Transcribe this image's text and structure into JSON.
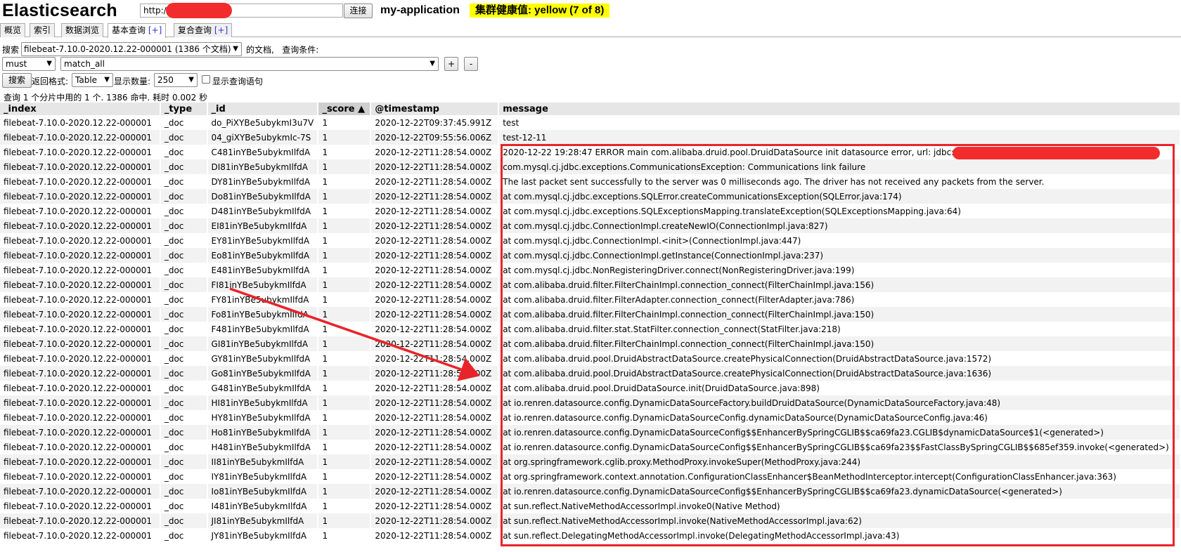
{
  "header": {
    "logo": "Elasticsearch",
    "url_value": "http://              9200/",
    "connect_label": "连接",
    "cluster_name": "my-application",
    "health_text": "集群健康值: yellow (7 of 8)",
    "health_color": "#ffff00"
  },
  "tabs": [
    {
      "label": "概览"
    },
    {
      "label": "索引"
    },
    {
      "label": "数据浏览"
    },
    {
      "label": "基本查询",
      "plus": "[+]"
    },
    {
      "label": "复合查询",
      "plus": "[+]"
    }
  ],
  "search": {
    "search_label": "搜索",
    "index_selected": "filebeat-7.10.0-2020.12.22-000001 (1386 个文档)",
    "of_docs_label": "的文档,",
    "query_cond_label": "查询条件:",
    "bool_selected": "must",
    "query_selected": "match_all",
    "add_label": "+",
    "remove_label": "-",
    "search_button": "搜索",
    "return_format_label": "返回格式:",
    "format_selected": "Table",
    "count_label": "显示数量:",
    "count_selected": "250",
    "show_query_label": "显示查询语句",
    "summary": "查询 1 个分片中用的 1 个. 1386 命中. 耗时 0.002 秒"
  },
  "table": {
    "columns": [
      "_index",
      "_type",
      "_id",
      "_score ▲",
      "@timestamp",
      "message"
    ],
    "rows": [
      [
        "filebeat-7.10.0-2020.12.22-000001",
        "_doc",
        "do_PiXYBe5ubykmI3u7V",
        "1",
        "2020-12-22T09:37:45.991Z",
        "test"
      ],
      [
        "filebeat-7.10.0-2020.12.22-000001",
        "_doc",
        "04_giXYBe5ubykmIc-7S",
        "1",
        "2020-12-22T09:55:56.006Z",
        "test-12-11"
      ],
      [
        "filebeat-7.10.0-2020.12.22-000001",
        "_doc",
        "C481inYBe5ubykmIlfdA",
        "1",
        "2020-12-22T11:28:54.000Z",
        "2020-12-22 19:28:47 ERROR main com.alibaba.druid.pool.DruidDataSource init datasource error, url: jdbc:                                                        :3306/"
      ],
      [
        "filebeat-7.10.0-2020.12.22-000001",
        "_doc",
        "DI81inYBe5ubykmIlfdA",
        "1",
        "2020-12-22T11:28:54.000Z",
        "com.mysql.cj.jdbc.exceptions.CommunicationsException: Communications link failure"
      ],
      [
        "filebeat-7.10.0-2020.12.22-000001",
        "_doc",
        "DY81inYBe5ubykmIlfdA",
        "1",
        "2020-12-22T11:28:54.000Z",
        "The last packet sent successfully to the server was 0 milliseconds ago. The driver has not received any packets from the server."
      ],
      [
        "filebeat-7.10.0-2020.12.22-000001",
        "_doc",
        "Do81inYBe5ubykmIlfdA",
        "1",
        "2020-12-22T11:28:54.000Z",
        "at com.mysql.cj.jdbc.exceptions.SQLError.createCommunicationsException(SQLError.java:174)"
      ],
      [
        "filebeat-7.10.0-2020.12.22-000001",
        "_doc",
        "D481inYBe5ubykmIlfdA",
        "1",
        "2020-12-22T11:28:54.000Z",
        "at com.mysql.cj.jdbc.exceptions.SQLExceptionsMapping.translateException(SQLExceptionsMapping.java:64)"
      ],
      [
        "filebeat-7.10.0-2020.12.22-000001",
        "_doc",
        "EI81inYBe5ubykmIlfdA",
        "1",
        "2020-12-22T11:28:54.000Z",
        "at com.mysql.cj.jdbc.ConnectionImpl.createNewIO(ConnectionImpl.java:827)"
      ],
      [
        "filebeat-7.10.0-2020.12.22-000001",
        "_doc",
        "EY81inYBe5ubykmIlfdA",
        "1",
        "2020-12-22T11:28:54.000Z",
        "at com.mysql.cj.jdbc.ConnectionImpl.<init>(ConnectionImpl.java:447)"
      ],
      [
        "filebeat-7.10.0-2020.12.22-000001",
        "_doc",
        "Eo81inYBe5ubykmIlfdA",
        "1",
        "2020-12-22T11:28:54.000Z",
        "at com.mysql.cj.jdbc.ConnectionImpl.getInstance(ConnectionImpl.java:237)"
      ],
      [
        "filebeat-7.10.0-2020.12.22-000001",
        "_doc",
        "E481inYBe5ubykmIlfdA",
        "1",
        "2020-12-22T11:28:54.000Z",
        "at com.mysql.cj.jdbc.NonRegisteringDriver.connect(NonRegisteringDriver.java:199)"
      ],
      [
        "filebeat-7.10.0-2020.12.22-000001",
        "_doc",
        "FI81inYBe5ubykmIlfdA",
        "1",
        "2020-12-22T11:28:54.000Z",
        "at com.alibaba.druid.filter.FilterChainImpl.connection_connect(FilterChainImpl.java:156)"
      ],
      [
        "filebeat-7.10.0-2020.12.22-000001",
        "_doc",
        "FY81inYBe5ubykmIlfdA",
        "1",
        "2020-12-22T11:28:54.000Z",
        "at com.alibaba.druid.filter.FilterAdapter.connection_connect(FilterAdapter.java:786)"
      ],
      [
        "filebeat-7.10.0-2020.12.22-000001",
        "_doc",
        "Fo81inYBe5ubykmIlfdA",
        "1",
        "2020-12-22T11:28:54.000Z",
        "at com.alibaba.druid.filter.FilterChainImpl.connection_connect(FilterChainImpl.java:150)"
      ],
      [
        "filebeat-7.10.0-2020.12.22-000001",
        "_doc",
        "F481inYBe5ubykmIlfdA",
        "1",
        "2020-12-22T11:28:54.000Z",
        "at com.alibaba.druid.filter.stat.StatFilter.connection_connect(StatFilter.java:218)"
      ],
      [
        "filebeat-7.10.0-2020.12.22-000001",
        "_doc",
        "GI81inYBe5ubykmIlfdA",
        "1",
        "2020-12-22T11:28:54.000Z",
        "at com.alibaba.druid.filter.FilterChainImpl.connection_connect(FilterChainImpl.java:150)"
      ],
      [
        "filebeat-7.10.0-2020.12.22-000001",
        "_doc",
        "GY81inYBe5ubykmIlfdA",
        "1",
        "2020-12-22T11:28:54.000Z",
        "at com.alibaba.druid.pool.DruidAbstractDataSource.createPhysicalConnection(DruidAbstractDataSource.java:1572)"
      ],
      [
        "filebeat-7.10.0-2020.12.22-000001",
        "_doc",
        "Go81inYBe5ubykmIlfdA",
        "1",
        "2020-12-22T11:28:54.000Z",
        "at com.alibaba.druid.pool.DruidAbstractDataSource.createPhysicalConnection(DruidAbstractDataSource.java:1636)"
      ],
      [
        "filebeat-7.10.0-2020.12.22-000001",
        "_doc",
        "G481inYBe5ubykmIlfdA",
        "1",
        "2020-12-22T11:28:54.000Z",
        "at com.alibaba.druid.pool.DruidDataSource.init(DruidDataSource.java:898)"
      ],
      [
        "filebeat-7.10.0-2020.12.22-000001",
        "_doc",
        "HI81inYBe5ubykmIlfdA",
        "1",
        "2020-12-22T11:28:54.000Z",
        "at io.renren.datasource.config.DynamicDataSourceFactory.buildDruidDataSource(DynamicDataSourceFactory.java:48)"
      ],
      [
        "filebeat-7.10.0-2020.12.22-000001",
        "_doc",
        "HY81inYBe5ubykmIlfdA",
        "1",
        "2020-12-22T11:28:54.000Z",
        "at io.renren.datasource.config.DynamicDataSourceConfig.dynamicDataSource(DynamicDataSourceConfig.java:46)"
      ],
      [
        "filebeat-7.10.0-2020.12.22-000001",
        "_doc",
        "Ho81inYBe5ubykmIlfdA",
        "1",
        "2020-12-22T11:28:54.000Z",
        "at io.renren.datasource.config.DynamicDataSourceConfig$$EnhancerBySpringCGLIB$$ca69fa23.CGLIB$dynamicDataSource$1(<generated>)"
      ],
      [
        "filebeat-7.10.0-2020.12.22-000001",
        "_doc",
        "H481inYBe5ubykmIlfdA",
        "1",
        "2020-12-22T11:28:54.000Z",
        "at io.renren.datasource.config.DynamicDataSourceConfig$$EnhancerBySpringCGLIB$$ca69fa23$$FastClassBySpringCGLIB$$685ef359.invoke(<generated>)"
      ],
      [
        "filebeat-7.10.0-2020.12.22-000001",
        "_doc",
        "II81inYBe5ubykmIlfdA",
        "1",
        "2020-12-22T11:28:54.000Z",
        "at org.springframework.cglib.proxy.MethodProxy.invokeSuper(MethodProxy.java:244)"
      ],
      [
        "filebeat-7.10.0-2020.12.22-000001",
        "_doc",
        "IY81inYBe5ubykmIlfdA",
        "1",
        "2020-12-22T11:28:54.000Z",
        "at org.springframework.context.annotation.ConfigurationClassEnhancer$BeanMethodInterceptor.intercept(ConfigurationClassEnhancer.java:363)"
      ],
      [
        "filebeat-7.10.0-2020.12.22-000001",
        "_doc",
        "Io81inYBe5ubykmIlfdA",
        "1",
        "2020-12-22T11:28:54.000Z",
        "at io.renren.datasource.config.DynamicDataSourceConfig$$EnhancerBySpringCGLIB$$ca69fa23.dynamicDataSource(<generated>)"
      ],
      [
        "filebeat-7.10.0-2020.12.22-000001",
        "_doc",
        "I481inYBe5ubykmIlfdA",
        "1",
        "2020-12-22T11:28:54.000Z",
        "at sun.reflect.NativeMethodAccessorImpl.invoke0(Native Method)"
      ],
      [
        "filebeat-7.10.0-2020.12.22-000001",
        "_doc",
        "JI81inYBe5ubykmIlfdA",
        "1",
        "2020-12-22T11:28:54.000Z",
        "at sun.reflect.NativeMethodAccessorImpl.invoke(NativeMethodAccessorImpl.java:62)"
      ],
      [
        "filebeat-7.10.0-2020.12.22-000001",
        "_doc",
        "JY81inYBe5ubykmIlfdA",
        "1",
        "2020-12-22T11:28:54.000Z",
        "at sun.reflect.DelegatingMethodAccessorImpl.invoke(DelegatingMethodAccessorImpl.java:43)"
      ]
    ]
  },
  "annotation": {
    "box_color": "#e8242a",
    "arrow_color": "#e8242a"
  }
}
